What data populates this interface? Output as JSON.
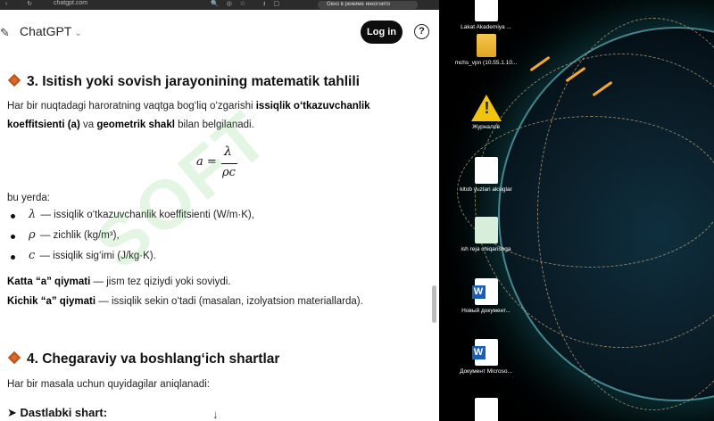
{
  "browser": {
    "url": "chatgpt.com",
    "incognito_label": "Окно в режиме инкогнито"
  },
  "header": {
    "model_name": "ChatGPT",
    "login_label": "Log in",
    "help_label": "?"
  },
  "article": {
    "section3_title": "3. Isitish yoki sovish jarayonining matematik tahlili",
    "para1_prefix": "Har bir nuqtadagi haroratning vaqtga bog‘liq o‘zgarishi ",
    "para1_bold1": "issiqlik o‘tkazuvchanlik koeffitsienti (a)",
    "para1_mid": " va ",
    "para1_bold2": "geometrik shakl",
    "para1_suffix": " bilan belgilanadi.",
    "formula": {
      "lhs": "a =",
      "numerator": "λ",
      "denominator": "ρc"
    },
    "bu_yerda": "bu yerda:",
    "bullets": [
      {
        "symbol": "λ",
        "text": "— issiqlik o‘tkazuvchanlik koeffitsienti (W/m·K),"
      },
      {
        "symbol": "ρ",
        "text": "— zichlik (kg/m³),"
      },
      {
        "symbol": "c",
        "text": "— issiqlik sig‘imi (J/kg·K)."
      }
    ],
    "katta_bold": "Katta “a” qiymati",
    "katta_text": " — jism tez qiziydi yoki soviydi.",
    "kichik_bold": "Kichik “a” qiymati",
    "kichik_text": " — issiqlik sekin o‘tadi (masalan, izolyatsion materiallarda).",
    "section4_title": "4. Chegaraviy va boshlang‘ich shartlar",
    "para2": "Har bir masala uchun quyidagilar aniqlanadi:",
    "dastlabki": "➤ Dastlabki shart:"
  },
  "watermark": "SOFT",
  "desktop": {
    "icons": [
      {
        "label": "Lakat Akademiya ...",
        "kind": "doc"
      },
      {
        "label": "mchs_vpn (10.55.1.10...",
        "kind": "folder"
      },
      {
        "label": "Журналов",
        "kind": "warning"
      },
      {
        "label": "kitob yuzlari aksiglar",
        "kind": "doc"
      },
      {
        "label": "ish reja chiqarishga",
        "kind": "doc-green"
      },
      {
        "label": "Новый документ...",
        "kind": "word"
      },
      {
        "label": "Документ Microso...",
        "kind": "word"
      }
    ]
  },
  "colors": {
    "accent_diamond": "#d76a2d",
    "login_bg": "#0d0d0d",
    "globe_glow": "#28b4c8"
  }
}
